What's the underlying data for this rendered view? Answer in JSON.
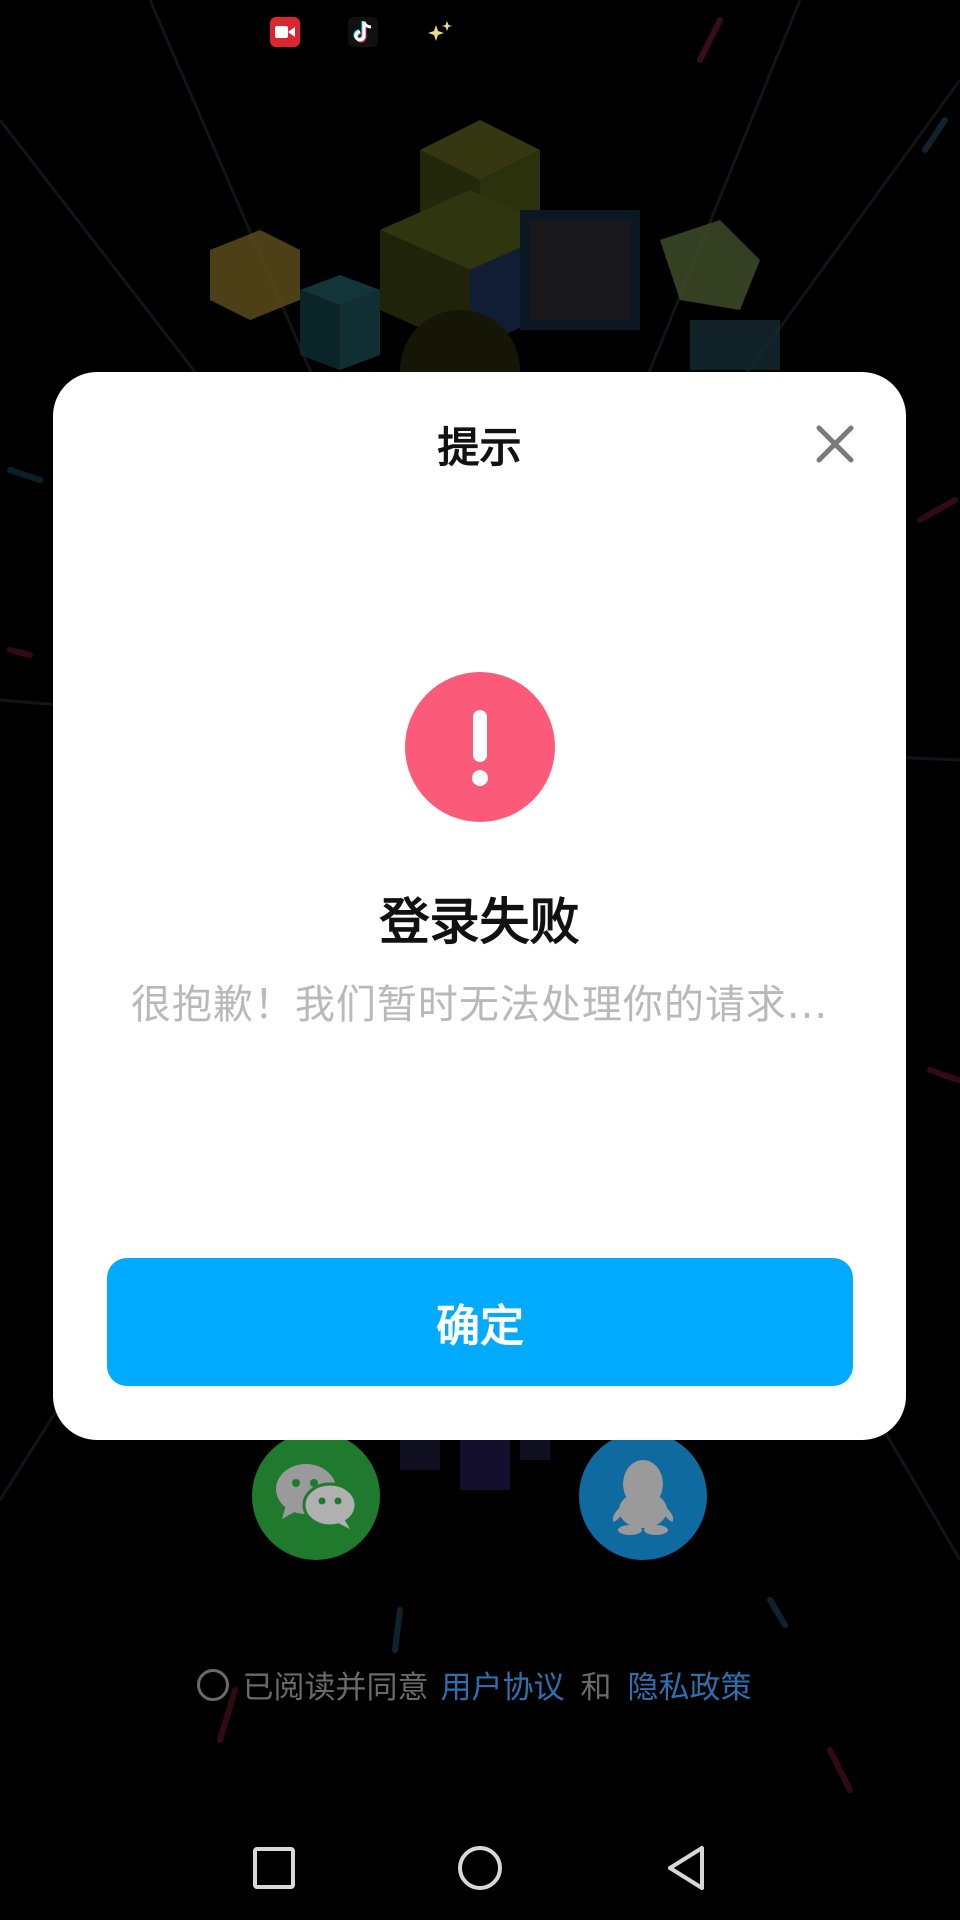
{
  "status_bar": {
    "icons": [
      "video-app-icon",
      "tiktok-icon",
      "sparkle-icon"
    ]
  },
  "dialog": {
    "title": "提示",
    "close_icon": "close-icon",
    "alert_icon": "exclamation-icon",
    "error_title": "登录失败",
    "error_message": "很抱歉！我们暂时无法处理你的请求...",
    "confirm_label": "确定"
  },
  "login": {
    "wechat_icon": "wechat-icon",
    "qq_icon": "qq-icon"
  },
  "agreement": {
    "prefix": "已阅读并同意",
    "user_agreement": "用户协议",
    "and": "和",
    "privacy_policy": "隐私政策"
  },
  "nav_bar": {
    "buttons": [
      "recents-square-icon",
      "home-circle-icon",
      "back-triangle-icon"
    ]
  },
  "colors": {
    "accent": "#00aaff",
    "alert": "#fb5a78",
    "link": "#2f6fae",
    "wechat": "#1f7a2e",
    "qq": "#0f6aa0"
  }
}
